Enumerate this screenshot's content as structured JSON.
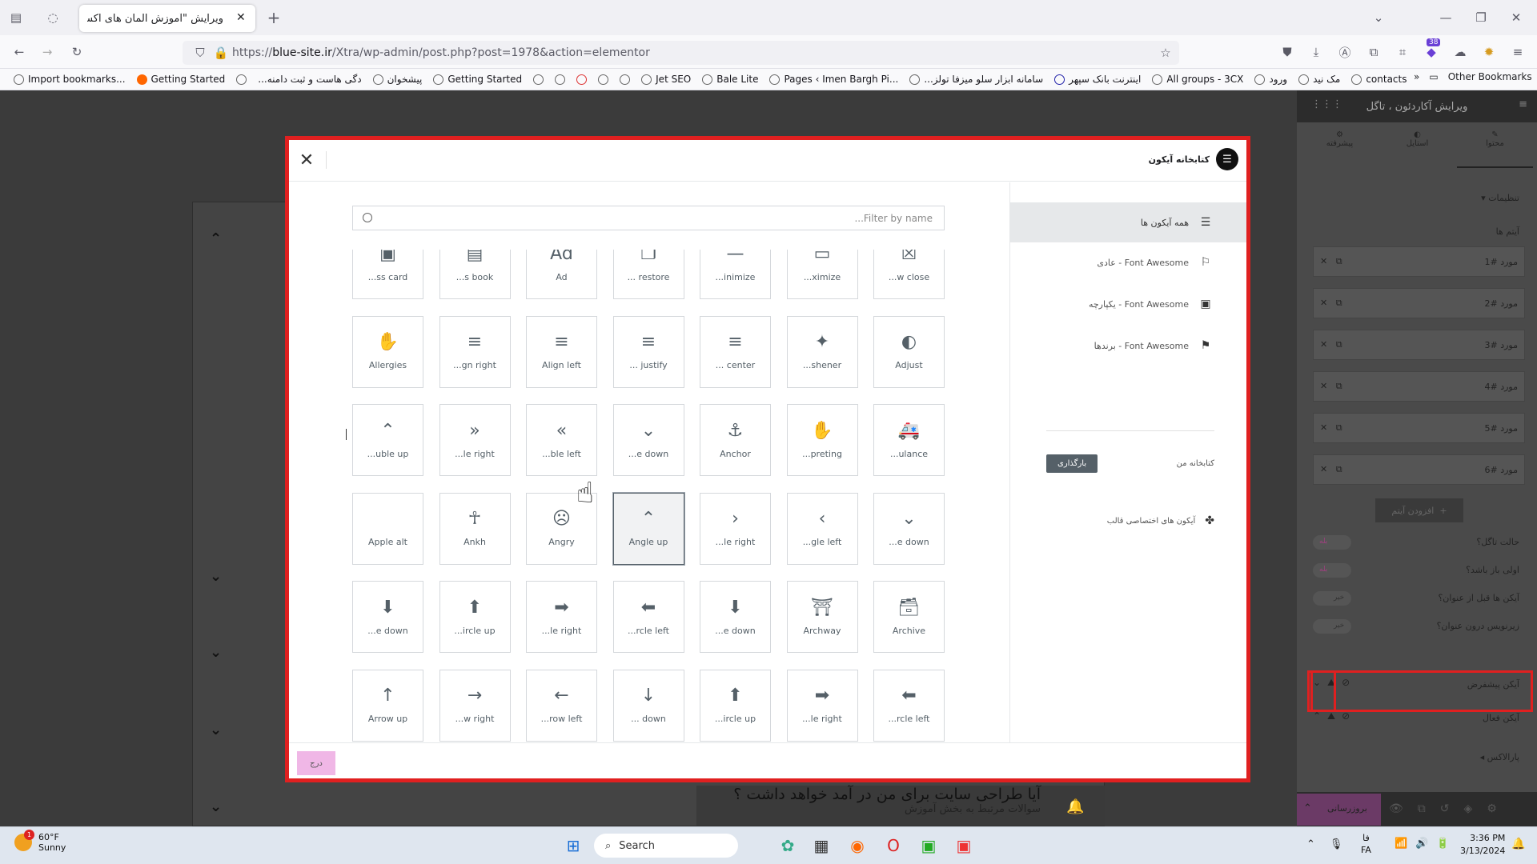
{
  "browser": {
    "tab_title": "ویرایش \"آموزش المان های اکسترا – ...",
    "url_prefix": "https://",
    "url_domain": "blue-site.ir",
    "url_path": "/Xtra/wp-admin/post.php?post=1978&action=elementor",
    "extension_badge": "38",
    "bookmarks": [
      "Import bookmarks...",
      "Getting Started",
      "...دگی هاست و ثبت دامنه",
      "پیشخوان",
      "Getting Started",
      "Jet SEO",
      "Bale Lite",
      "Pages ‹ Imen Bargh Pi...",
      "...سامانه ابزار سلو میزفا تولز",
      "اینترنت بانک سپهر",
      "All groups - 3CX",
      "ورود",
      "مک نید",
      "contacts"
    ],
    "other_bookmarks": "Other Bookmarks"
  },
  "editor_panel": {
    "header_title": "ویرایش آکاردئون ، تاگل",
    "tabs": [
      "محتوا",
      "استایل",
      "پیشرفته"
    ],
    "section_settings": "تنظیمات",
    "items_label": "آیتم ها",
    "items": [
      "مورد #1",
      "مورد #2",
      "مورد #3",
      "مورد #4",
      "مورد #5",
      "مورد #6"
    ],
    "add_item": "افزودن آیتم",
    "toggles": [
      {
        "label": "حالت تاگل؟",
        "value": "بله"
      },
      {
        "label": "اولی باز باشد؟",
        "value": "بله"
      },
      {
        "label": "آیکن ها قبل از عنوان؟",
        "value": "خیر"
      },
      {
        "label": "زیرنویس درون عنوان؟",
        "value": "خیر"
      }
    ],
    "default_icon_label": "آیکن پیشفرض",
    "active_icon_label": "آیکن فعال",
    "parallax": "پارالاکس",
    "update_button": "بروزرسانی"
  },
  "preview": {
    "faq_question": "آیا طراحی سایت برای من در آمد خواهد داشت ؟",
    "faq_sub": "سوالات مرتبط به بخش آموزش"
  },
  "modal": {
    "title": "کتابخانه آیکون",
    "search_placeholder": "Filter by name...",
    "insert_button": "درج",
    "categories": [
      {
        "label": "همه آیکون ها",
        "icon": "filter-icon"
      },
      {
        "label": "Font Awesome - عادی",
        "icon": "regular-icon"
      },
      {
        "label": "Font Awesome - یکپارچه",
        "icon": "solid-icon"
      },
      {
        "label": "Font Awesome - برندها",
        "icon": "brands-icon"
      }
    ],
    "my_library": "کتابخانه من",
    "upload_button": "بارگذاری",
    "custom_icons": "آیکون های اختصاصی قالب",
    "icons": [
      [
        "▣",
        "...ss card"
      ],
      [
        "▤",
        "...s book"
      ],
      [
        "Ad",
        "Ad"
      ],
      [
        "❐",
        "... restore"
      ],
      [
        "—",
        "...inimize"
      ],
      [
        "▭",
        "...ximize"
      ],
      [
        "☒",
        "...w close"
      ],
      [
        "✋",
        "Allergies"
      ],
      [
        "≡",
        "...gn right"
      ],
      [
        "≡",
        "Align left"
      ],
      [
        "≡",
        "... justify"
      ],
      [
        "≡",
        "... center"
      ],
      [
        "✦",
        "...shener"
      ],
      [
        "◐",
        "Adjust"
      ],
      [
        "⌃",
        "...uble up"
      ],
      [
        "»",
        "...le right"
      ],
      [
        "«",
        "...ble left"
      ],
      [
        "⌄",
        "...e down"
      ],
      [
        "⚓",
        "Anchor"
      ],
      [
        "✋",
        "...preting"
      ],
      [
        "🚑",
        "...ulance"
      ],
      [
        "",
        "Apple alt"
      ],
      [
        "☥",
        "Ankh"
      ],
      [
        "☹",
        "Angry"
      ],
      [
        "⌃",
        "Angle up"
      ],
      [
        "›",
        "...le right"
      ],
      [
        "‹",
        "...gle left"
      ],
      [
        "⌄",
        "...e down"
      ],
      [
        "⬇",
        "...e down"
      ],
      [
        "⬆",
        "...ircle up"
      ],
      [
        "➡",
        "...le right"
      ],
      [
        "⬅",
        "...rcle left"
      ],
      [
        "⬇",
        "...e down"
      ],
      [
        "⛩",
        "Archway"
      ],
      [
        "🗃",
        "Archive"
      ],
      [
        "↑",
        "Arrow up"
      ],
      [
        "→",
        "...w right"
      ],
      [
        "←",
        "...row left"
      ],
      [
        "↓",
        "... down"
      ],
      [
        "⬆",
        "...ircle up"
      ],
      [
        "➡",
        "...le right"
      ],
      [
        "⬅",
        "...rcle left"
      ]
    ],
    "selected_index": 24
  },
  "taskbar": {
    "temperature": "60°F",
    "weather": "Sunny",
    "weather_badge": "1",
    "search": "Search",
    "lang_top": "فا",
    "lang_bottom": "FA",
    "time": "3:36 PM",
    "date": "3/13/2024"
  }
}
